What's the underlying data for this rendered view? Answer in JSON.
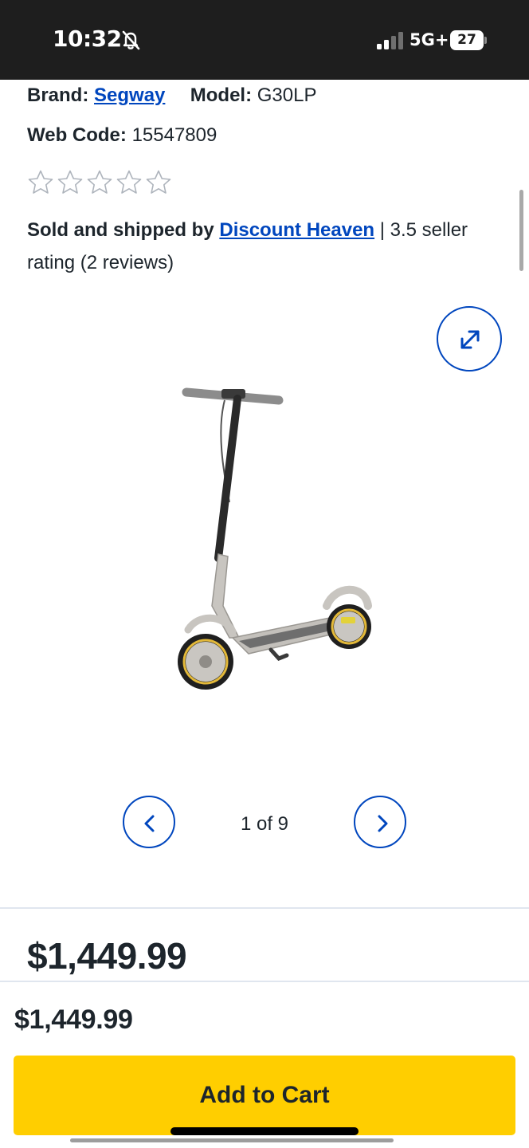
{
  "status_bar": {
    "time": "10:32",
    "network": "5G+",
    "battery_level": "27",
    "icons": [
      "bell-slash-icon",
      "signal-bars-icon",
      "battery-icon"
    ]
  },
  "product": {
    "brand_label": "Brand:",
    "brand": "Segway",
    "model_label": "Model:",
    "model": "G30LP",
    "web_code_label": "Web Code:",
    "web_code": "15547809",
    "rating_stars_filled": 0,
    "rating_stars_total": 5,
    "sold_by_label": "Sold and shipped by",
    "seller_name": "Discount Heaven",
    "seller_rating_text": " | 3.5 seller rating (2 reviews)"
  },
  "gallery": {
    "counter": "1 of 9",
    "current_index": 1,
    "total": 9,
    "icons": [
      "expand-icon",
      "chevron-left-icon",
      "chevron-right-icon"
    ]
  },
  "price": "$1,449.99",
  "sticky_footer": {
    "price": "$1,449.99",
    "add_to_cart_label": "Add to Cart"
  },
  "colors": {
    "link_blue": "#0046be",
    "cta_yellow": "#ffce00",
    "text_dark": "#1d252c",
    "status_bar_bg": "#1e1e1e"
  }
}
